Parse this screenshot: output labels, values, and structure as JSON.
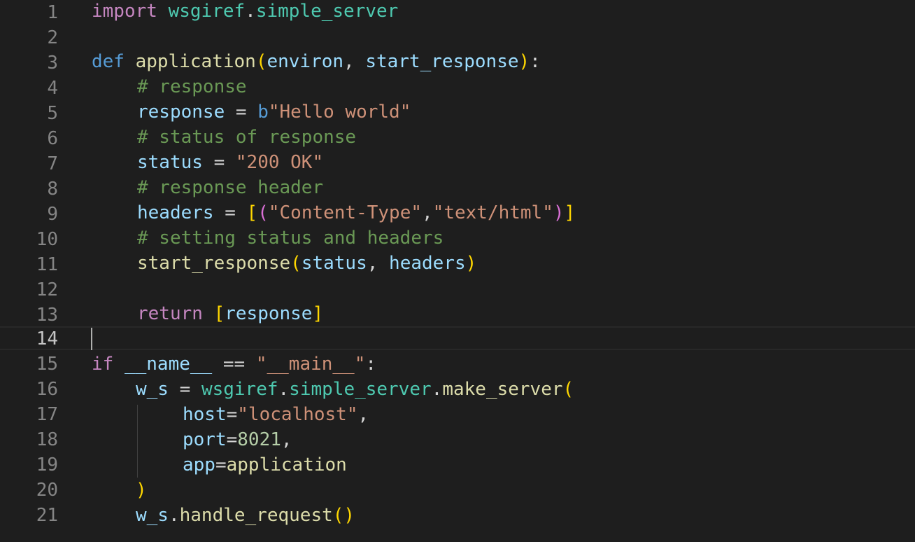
{
  "editor": {
    "language": "python",
    "theme_colors": {
      "background": "#1e1e1e",
      "keyword": "#c586c0",
      "def_keyword": "#569cd6",
      "module": "#4ec9b0",
      "function": "#dcdcaa",
      "variable": "#9cdcfe",
      "comment": "#6a9955",
      "string": "#ce9178",
      "number": "#b5cea8"
    },
    "active_line": "14",
    "line_numbers": [
      "1",
      "2",
      "3",
      "4",
      "5",
      "6",
      "7",
      "8",
      "9",
      "10",
      "11",
      "12",
      "13",
      "14",
      "15",
      "16",
      "17",
      "18",
      "19",
      "20",
      "21"
    ],
    "lines": {
      "l1": {
        "kw": "import",
        "mod": "wsgiref",
        "dot": ".",
        "mod2": "simple_server"
      },
      "l3": {
        "kw": "def",
        "fn": "application",
        "open": "(",
        "p1": "environ",
        "comma": ", ",
        "p2": "start_response",
        "close": ")",
        "colon": ":"
      },
      "l4": {
        "comment": "# response"
      },
      "l5": {
        "var": "response",
        "eq": " = ",
        "prefix": "b",
        "str": "\"Hello world\""
      },
      "l6": {
        "comment": "# status of response"
      },
      "l7": {
        "var": "status",
        "eq": " = ",
        "str": "\"200 OK\""
      },
      "l8": {
        "comment": "# response header"
      },
      "l9": {
        "var": "headers",
        "eq": " = ",
        "b_open": "[",
        "p_open": "(",
        "s1": "\"Content-Type\"",
        "comma": ",",
        "s2": "\"text/html\"",
        "p_close": ")",
        "b_close": "]"
      },
      "l10": {
        "comment": "# setting status and headers"
      },
      "l11": {
        "fn": "start_response",
        "open": "(",
        "a1": "status",
        "comma": ", ",
        "a2": "headers",
        "close": ")"
      },
      "l13": {
        "kw": "return",
        "sp": " ",
        "open": "[",
        "var": "response",
        "close": "]"
      },
      "l15": {
        "kw": "if",
        "sp": " ",
        "var": "__name__",
        "op": " == ",
        "str": "\"__main__\"",
        "colon": ":"
      },
      "l16": {
        "var": "w_s",
        "eq": " = ",
        "mod": "wsgiref",
        "dot": ".",
        "mod2": "simple_server",
        "dot2": ".",
        "fn": "make_server",
        "open": "("
      },
      "l17": {
        "param": "host",
        "eq": "=",
        "str": "\"localhost\"",
        "comma": ","
      },
      "l18": {
        "param": "port",
        "eq": "=",
        "num": "8021",
        "comma": ","
      },
      "l19": {
        "param": "app",
        "eq": "=",
        "fn": "application"
      },
      "l20": {
        "close": ")"
      },
      "l21": {
        "var": "w_s",
        "dot": ".",
        "fn": "handle_request",
        "parens": "()"
      }
    }
  }
}
